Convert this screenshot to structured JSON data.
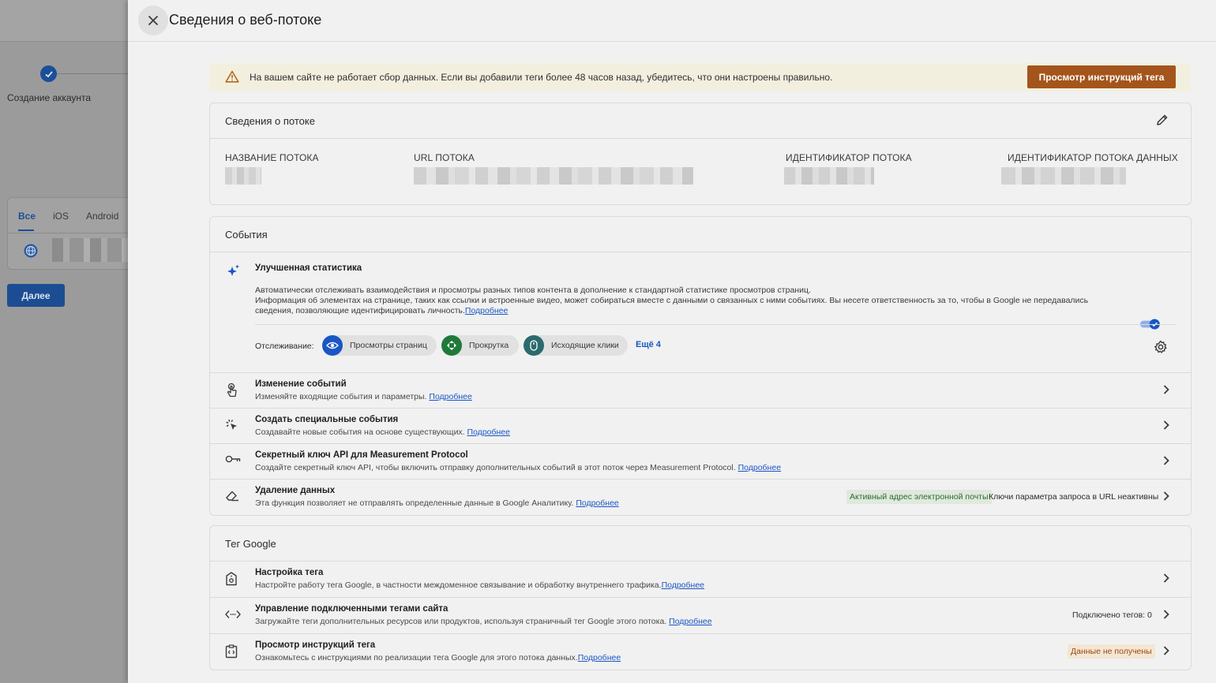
{
  "background": {
    "step_label": "Создание аккаунта",
    "tabs": [
      "Все",
      "iOS",
      "Android"
    ],
    "next_button": "Далее"
  },
  "header": {
    "title": "Сведения о веб-потоке"
  },
  "banner": {
    "text": "На вашем сайте не работает сбор данных. Если вы добавили теги более 48 часов назад, убедитесь, что они настроены правильно.",
    "button": "Просмотр инструкций тега"
  },
  "stream": {
    "title": "Сведения о потоке",
    "columns": [
      "НАЗВАНИЕ ПОТОКА",
      "URL ПОТОКА",
      "ИДЕНТИФИКАТОР ПОТОКА",
      "ИДЕНТИФИКАТОР ПОТОКА ДАННЫХ"
    ]
  },
  "events": {
    "title": "События",
    "enhanced": {
      "title": "Улучшенная статистика",
      "line1": "Автоматически отслеживать взаимодействия и просмотры разных типов контента в дополнение к стандартной статистике просмотров страниц.",
      "line2": "Информация об элементах на странице, таких как ссылки и встроенные видео, может собираться вместе с данными о связанных с ними событиях. Вы несете ответственность за то, чтобы в Google не передавались сведения, позволяющие идентифицировать личность.",
      "link": "Подробнее",
      "tracking_label": "Отслеживание:",
      "chips": [
        "Просмотры страниц",
        "Прокрутка",
        "Исходящие клики"
      ],
      "more": "Ещё 4"
    },
    "rows": [
      {
        "title": "Изменение событий",
        "desc": "Изменяйте входящие события и параметры.",
        "link": "Подробнее"
      },
      {
        "title": "Создать специальные события",
        "desc": "Создавайте новые события на основе существующих.",
        "link": "Подробнее"
      },
      {
        "title": "Секретный ключ API для Measurement Protocol",
        "desc": "Создайте секретный ключ API, чтобы включить отправку дополнительных событий в этот поток через Measurement Protocol.",
        "link": "Подробнее"
      },
      {
        "title": "Удаление данных",
        "desc": "Эта функция позволяет не отправлять определенные данные в Google Аналитику.",
        "link": "Подробнее",
        "chip_active": "Активный адрес электронной почты",
        "chip_inactive": "Ключи параметра запроса в URL неактивны"
      }
    ]
  },
  "google_tag": {
    "title": "Тег Google",
    "rows": [
      {
        "title": "Настройка тега",
        "desc": "Настройте работу тега Google, в частности междоменное связывание и обработку внутреннего трафика.",
        "link": "Подробнее"
      },
      {
        "title": "Управление подключенными тегами сайта",
        "desc": "Загружайте теги дополнительных ресурсов или продуктов, используя страничный тег Google этого потока.",
        "link": "Подробнее",
        "badge": "Подключено тегов: 0"
      },
      {
        "title": "Просмотр инструкций тега",
        "desc": "Ознакомьтесь с инструкциями по реализации тега Google для этого потока данных.",
        "link": "Подробнее",
        "badge": "Данные не получены"
      }
    ]
  },
  "colors": {
    "accent": "#1a56c4",
    "warning_button": "#a4551b",
    "banner_bg": "#f3efdf"
  }
}
